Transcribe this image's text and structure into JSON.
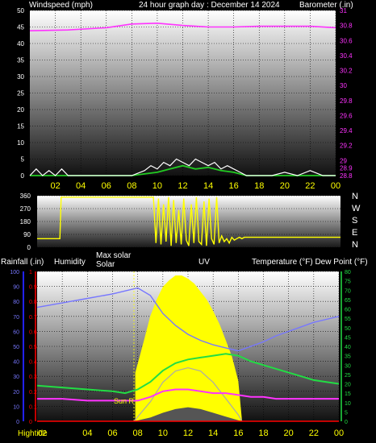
{
  "header": {
    "left": "Windspeed (mph)",
    "center": "24 hour graph day : December 14 2024",
    "right": "Barometer (.in)"
  },
  "middle_right_labels": [
    "N",
    "W",
    "S",
    "E",
    "N"
  ],
  "bottom_header": {
    "rain": "Rainfall (.in)",
    "humidity": "Humidity",
    "max_solar": "Max solar",
    "solar": "Solar",
    "uv": "UV",
    "temp": "Temperature (°F) Dew Point (°F)"
  },
  "bottom_labels": {
    "sunrise": "Sun R",
    "hightide": "Hightide",
    "time": "02"
  },
  "colors": {
    "wind_gust": "#ffffff",
    "wind_avg": "#22cc22",
    "barometer": "#ff33ff",
    "direction": "#ffff00",
    "humidity": "#7777ff",
    "solar": "#ffff00",
    "temperature": "#22dd44",
    "dewpoint": "#ff33ff",
    "rain": "#ff0000",
    "uv": "#555555",
    "max_solar": "#aaaaaa"
  },
  "chart_data": [
    {
      "type": "line",
      "name": "wind-barometer",
      "xticks": [
        "02",
        "04",
        "06",
        "08",
        "10",
        "12",
        "14",
        "16",
        "18",
        "20",
        "22",
        "00"
      ],
      "y_left_ticks": [
        0,
        5,
        10,
        15,
        20,
        25,
        30,
        35,
        40,
        45,
        50
      ],
      "y_right_ticks": [
        "28.8",
        "28.9",
        "29",
        "29.2",
        "29.4",
        "29.6",
        "29.8",
        "30",
        "30.2",
        "30.4",
        "30.6",
        "30.8",
        "31"
      ],
      "ylim_left": [
        0,
        50
      ],
      "ylim_right": [
        28.8,
        31.0
      ],
      "series": [
        {
          "key": "barometer",
          "x": [
            0,
            3,
            6,
            8,
            10,
            12,
            14,
            16,
            18,
            20,
            22,
            24
          ],
          "values": [
            30.73,
            30.74,
            30.77,
            30.82,
            30.83,
            30.8,
            30.78,
            30.78,
            30.79,
            30.79,
            30.79,
            30.77
          ]
        },
        {
          "key": "wind_avg",
          "x": [
            0,
            8,
            9,
            10,
            11,
            12,
            13,
            14,
            15,
            16,
            17,
            24
          ],
          "values": [
            0,
            0,
            0.5,
            1,
            2,
            3,
            2,
            2.5,
            1.5,
            1,
            0,
            0
          ]
        },
        {
          "key": "wind_gust",
          "x": [
            0,
            0.5,
            1,
            1.5,
            2,
            2.5,
            3,
            5,
            7,
            8,
            9,
            9.5,
            10,
            10.5,
            11,
            11.5,
            12,
            12.5,
            13,
            13.5,
            14,
            14.5,
            15,
            15.5,
            16,
            16.5,
            17,
            19,
            20,
            21,
            22,
            23,
            24
          ],
          "values": [
            0,
            2,
            0,
            1.5,
            0,
            2,
            0,
            0,
            0,
            0,
            1.5,
            3,
            2,
            4,
            3,
            5,
            4,
            3,
            5,
            4,
            3,
            4,
            2,
            3,
            2,
            1,
            0,
            0,
            1,
            0,
            1.5,
            0,
            0
          ]
        }
      ]
    },
    {
      "type": "line",
      "name": "wind-direction",
      "y_ticks": [
        0,
        90,
        180,
        270,
        360
      ],
      "ylim": [
        0,
        360
      ],
      "series": [
        {
          "key": "direction",
          "x": [
            0,
            0.2,
            1.8,
            1.9,
            9.2,
            9.4,
            9.6,
            9.8,
            10,
            10.2,
            10.4,
            10.6,
            10.8,
            11,
            11.2,
            11.4,
            11.6,
            11.8,
            12,
            12.2,
            12.4,
            12.6,
            12.8,
            13,
            13.2,
            13.4,
            13.6,
            13.8,
            14,
            14.2,
            14.4,
            14.6,
            14.8,
            15,
            15.2,
            15.4,
            15.6,
            15.8,
            16,
            16.2,
            16.4,
            16.6,
            24
          ],
          "values": [
            60,
            60,
            60,
            350,
            350,
            30,
            340,
            20,
            300,
            40,
            350,
            10,
            330,
            30,
            260,
            20,
            340,
            50,
            10,
            300,
            30,
            350,
            40,
            20,
            320,
            10,
            340,
            60,
            20,
            350,
            30,
            80,
            40,
            60,
            30,
            70,
            50,
            60,
            70,
            60,
            70,
            70,
            70
          ]
        }
      ]
    },
    {
      "type": "line",
      "name": "weather-combined",
      "y_rain_ticks": [
        "0",
        "0.1",
        "0.2",
        "0.3",
        "0.4",
        "0.5",
        "0.6",
        "0.7",
        "0.8",
        "0.9",
        "1"
      ],
      "y_humidity_ticks": [
        0,
        10,
        20,
        30,
        40,
        50,
        60,
        70,
        80,
        90,
        100
      ],
      "y_temp_ticks": [
        0,
        5,
        10,
        15,
        20,
        25,
        30,
        35,
        40,
        45,
        50,
        55,
        60,
        65,
        70,
        75,
        80
      ],
      "series": [
        {
          "key": "humidity",
          "x": [
            0,
            2,
            4,
            6,
            7,
            8,
            9,
            10,
            11,
            12,
            13,
            14,
            15,
            16,
            17,
            18,
            19,
            20,
            21,
            22,
            23,
            24
          ],
          "values": [
            76,
            79,
            82,
            85,
            87,
            89,
            84,
            72,
            64,
            58,
            54,
            51,
            49,
            47,
            50,
            53,
            57,
            60,
            63,
            66,
            68,
            70
          ]
        },
        {
          "key": "temperature",
          "x": [
            0,
            2,
            4,
            6,
            7,
            8,
            9,
            10,
            11,
            12,
            13,
            14,
            15,
            16,
            17,
            18,
            19,
            20,
            21,
            22,
            23,
            24
          ],
          "values": [
            19,
            18,
            17,
            16,
            15,
            17,
            21,
            27,
            31,
            33,
            34,
            35,
            36,
            35,
            32,
            30,
            28,
            26,
            24,
            22,
            21,
            20
          ]
        },
        {
          "key": "dewpoint",
          "x": [
            0,
            2,
            4,
            6,
            8,
            9,
            10,
            11,
            12,
            13,
            14,
            15,
            16,
            17,
            18,
            19,
            20,
            22,
            24
          ],
          "values": [
            12,
            12,
            11,
            11,
            11,
            13,
            16,
            17,
            17,
            16,
            15,
            15,
            14,
            13,
            13,
            12,
            12,
            12,
            12
          ]
        },
        {
          "key": "solar",
          "x": [
            7.8,
            8.5,
            9,
            9.5,
            10,
            10.5,
            11,
            11.5,
            12,
            12.5,
            13,
            13.5,
            14,
            14.5,
            15,
            15.5,
            16,
            16.3
          ],
          "values": [
            300,
            500,
            650,
            750,
            830,
            870,
            900,
            900,
            880,
            850,
            800,
            750,
            680,
            600,
            500,
            400,
            250,
            0
          ]
        },
        {
          "key": "max_solar",
          "x": [
            7.7,
            9,
            10,
            11,
            12,
            13,
            14,
            15,
            16,
            16.3
          ],
          "values": [
            0,
            120,
            240,
            310,
            330,
            310,
            240,
            140,
            40,
            0
          ]
        },
        {
          "key": "uv",
          "x": [
            7.7,
            9,
            10,
            11,
            12,
            13,
            14,
            15,
            16,
            16.3
          ],
          "values": [
            0,
            0.4,
            0.9,
            1.3,
            1.5,
            1.3,
            0.9,
            0.5,
            0.1,
            0
          ]
        },
        {
          "key": "rain",
          "x": [
            0,
            24
          ],
          "values": [
            0,
            0
          ]
        }
      ]
    }
  ]
}
